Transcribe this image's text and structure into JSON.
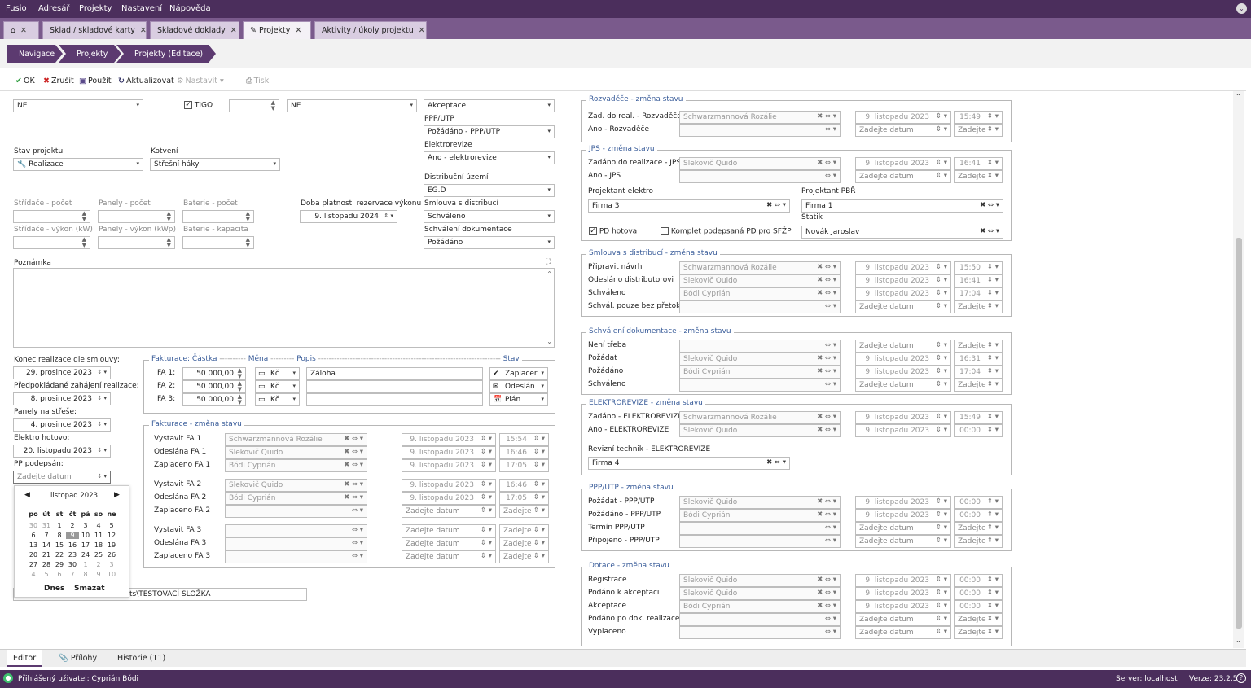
{
  "menu": [
    "Fusio",
    "Adresář",
    "Projekty",
    "Nastavení",
    "Nápověda"
  ],
  "tabs": [
    {
      "label": "Sklad / skladové karty"
    },
    {
      "label": "Skladové doklady"
    },
    {
      "label": "Projekty"
    },
    {
      "label": "Aktivity / úkoly projektu"
    }
  ],
  "breadcrumb": [
    "Navigace",
    "Projekty",
    "Projekty (Editace)"
  ],
  "toolbar": {
    "ok": "OK",
    "cancel": "Zrušit",
    "apply": "Použít",
    "refresh": "Aktualizovat",
    "settings": "Nastavit",
    "print": "Tisk"
  },
  "left": {
    "top_select1": "NE",
    "tigo_label": "TIGO",
    "top_select2": "NE",
    "acceptance_select": "Akceptace",
    "ppp_label": "PPP/UTP",
    "ppp_value": "Požádáno - PPP/UTP",
    "elektro_label": "Elektrorevize",
    "elektro_value": "Ano - elektrorevize",
    "stav_label": "Stav projektu",
    "stav_value": "Realizace",
    "kotveni_label": "Kotvení",
    "kotveni_value": "Střešní háky",
    "distrib_label": "Distribuční území",
    "distrib_value": "EG.D",
    "stridace_pocet": "Střídače - počet",
    "panely_pocet": "Panely - počet",
    "baterie_pocet": "Baterie - počet",
    "doba_label": "Doba platnosti rezervace výkonu",
    "doba_value": "9. listopadu 2024",
    "smlouva_label": "Smlouva s distribucí",
    "smlouva_value": "Schváleno",
    "stridace_vykon": "Střídače - výkon (kW)",
    "panely_vykon": "Panely - výkon (kWp)",
    "baterie_kapacita": "Baterie - kapacita",
    "schvaleni_label": "Schválení dokumentace",
    "schvaleni_value": "Požádáno",
    "poznamka_label": "Poznámka",
    "konec_label": "Konec realizace dle smlouvy:",
    "konec_value": "29. prosince 2023",
    "predpokl_label": "Předpokládané zahájení realizace:",
    "predpokl_value": "8. prosince 2023",
    "panely_strecha_label": "Panely na střeše:",
    "panely_strecha_value": "4. prosince 2023",
    "elektro_hotovo_label": "Elektro hotovo:",
    "elektro_hotovo_value": "20. listopadu 2023",
    "pp_label": "PP podepsán:",
    "pp_placeholder": "Zadejte datum",
    "path_value": "ts\\TESTOVACÍ SLOŽKA"
  },
  "fakturace": {
    "header_label": "Fakturace:",
    "col_castka": "Částka",
    "col_mena": "Měna",
    "col_popis": "Popis",
    "col_stav": "Stav",
    "sep1": "----------",
    "sep2": "---------",
    "sep3": "---------------------------------------------------------------------",
    "rows": [
      {
        "label": "FA 1:",
        "amount": "50 000,00",
        "currency": "Kč",
        "desc": "Záloha",
        "status": "Zaplacer"
      },
      {
        "label": "FA 2:",
        "amount": "50 000,00",
        "currency": "Kč",
        "desc": "",
        "status": "Odeslán"
      },
      {
        "label": "FA 3:",
        "amount": "50 000,00",
        "currency": "Kč",
        "desc": "",
        "status": "Plán"
      }
    ]
  },
  "fakturace_zmena": {
    "title": "Fakturace - změna stavu",
    "rows": [
      {
        "label": "Vystavit FA 1",
        "person": "Schwarzmannová Rozálie",
        "date": "9. listopadu 2023",
        "time": "15:54"
      },
      {
        "label": "Odeslána FA 1",
        "person": "Slekovič Quido",
        "date": "9. listopadu 2023",
        "time": "16:46"
      },
      {
        "label": "Zaplaceno FA 1",
        "person": "Bódi Cyprián",
        "date": "9. listopadu 2023",
        "time": "17:05"
      },
      {
        "label": "Vystavit FA 2",
        "person": "Slekovič Quido",
        "date": "9. listopadu 2023",
        "time": "16:46"
      },
      {
        "label": "Odeslána FA 2",
        "person": "Bódi Cyprián",
        "date": "9. listopadu 2023",
        "time": "17:05"
      },
      {
        "label": "Zaplaceno FA 2",
        "person": "",
        "date": "Zadejte datum",
        "time": "Zadejte"
      },
      {
        "label": "Vystavit FA 3",
        "person": "",
        "date": "Zadejte datum",
        "time": "Zadejte"
      },
      {
        "label": "Odeslána FA 3",
        "person": "",
        "date": "Zadejte datum",
        "time": "Zadejte"
      },
      {
        "label": "Zaplaceno FA 3",
        "person": "",
        "date": "Zadejte datum",
        "time": "Zadejte"
      }
    ]
  },
  "calendar": {
    "month": "listopad 2023",
    "days": [
      "po",
      "út",
      "st",
      "čt",
      "pá",
      "so",
      "ne"
    ],
    "weeks": [
      [
        "30",
        "31",
        "1",
        "2",
        "3",
        "4",
        "5"
      ],
      [
        "6",
        "7",
        "8",
        "9",
        "10",
        "11",
        "12"
      ],
      [
        "13",
        "14",
        "15",
        "16",
        "17",
        "18",
        "19"
      ],
      [
        "20",
        "21",
        "22",
        "23",
        "24",
        "25",
        "26"
      ],
      [
        "27",
        "28",
        "29",
        "30",
        "1",
        "2",
        "3"
      ],
      [
        "4",
        "5",
        "6",
        "7",
        "8",
        "9",
        "10"
      ]
    ],
    "today": "Dnes",
    "clear": "Smazat"
  },
  "right": {
    "rozvadece": {
      "title": "Rozvaděče - změna stavu",
      "rows": [
        {
          "label": "Zad. do real. - Rozvaděče",
          "person": "Schwarzmannová Rozálie",
          "date": "9. listopadu 2023",
          "time": "15:49"
        },
        {
          "label": "Ano - Rozvaděče",
          "person": "",
          "date": "Zadejte datum",
          "time": "Zadejte"
        }
      ]
    },
    "jps": {
      "title": "JPS - změna stavu",
      "rows": [
        {
          "label": "Zadáno do realizace - JPS",
          "person": "Slekovič Quido",
          "date": "9. listopadu 2023",
          "time": "16:41"
        },
        {
          "label": "Ano - JPS",
          "person": "",
          "date": "Zadejte datum",
          "time": "Zadejte"
        }
      ],
      "projektant_elektro_label": "Projektant elektro",
      "projektant_elektro": "Firma 3",
      "projektant_pbr_label": "Projektant PBŘ",
      "projektant_pbr": "Firma 1",
      "statik_label": "Statik",
      "statik": "Novák Jaroslav",
      "pd_hotova": "PD hotova",
      "komplet": "Komplet podepsaná PD pro SFŽP"
    },
    "smlouva": {
      "title": "Smlouva s distribucí - změna stavu",
      "rows": [
        {
          "label": "Připravit návrh",
          "person": "Schwarzmannová Rozálie",
          "date": "9. listopadu 2023",
          "time": "15:50"
        },
        {
          "label": "Odesláno distributorovi",
          "person": "Slekovič Quido",
          "date": "9. listopadu 2023",
          "time": "16:41"
        },
        {
          "label": "Schváleno",
          "person": "Bódi Cyprián",
          "date": "9. listopadu 2023",
          "time": "17:04"
        },
        {
          "label": "Schvál. pouze bez přetoku",
          "person": "",
          "date": "Zadejte datum",
          "time": "Zadejte"
        }
      ]
    },
    "schvaleni": {
      "title": "Schválení dokumentace - změna stavu",
      "rows": [
        {
          "label": "Není třeba",
          "person": "",
          "date": "Zadejte datum",
          "time": "Zadejte"
        },
        {
          "label": "Požádat",
          "person": "Slekovič Quido",
          "date": "9. listopadu 2023",
          "time": "16:31"
        },
        {
          "label": "Požádáno",
          "person": "Bódi Cyprián",
          "date": "9. listopadu 2023",
          "time": "17:04"
        },
        {
          "label": "Schváleno",
          "person": "",
          "date": "Zadejte datum",
          "time": "Zadejte"
        }
      ]
    },
    "elektrorevize": {
      "title": "ELEKTROREVIZE - změna stavu",
      "rows": [
        {
          "label": "Zadáno - ELEKTROREVIZE",
          "person": "Schwarzmannová Rozálie",
          "date": "9. listopadu 2023",
          "time": "15:49"
        },
        {
          "label": "Ano - ELEKTROREVIZE",
          "person": "Slekovič Quido",
          "date": "9. listopadu 2023",
          "time": "00:00"
        }
      ],
      "technik_label": "Revizní technik - ELEKTROREVIZE",
      "technik": "Firma 4"
    },
    "ppp": {
      "title": "PPP/UTP - změna stavu",
      "rows": [
        {
          "label": "Požádat - PPP/UTP",
          "person": "Slekovič Quido",
          "date": "9. listopadu 2023",
          "time": "00:00"
        },
        {
          "label": "Požádáno - PPP/UTP",
          "person": "Bódi Cyprián",
          "date": "9. listopadu 2023",
          "time": "00:00"
        },
        {
          "label": "Termín PPP/UTP",
          "person": "",
          "date": "Zadejte datum",
          "time": "Zadejte"
        },
        {
          "label": "Připojeno - PPP/UTP",
          "person": "",
          "date": "Zadejte datum",
          "time": "Zadejte"
        }
      ]
    },
    "dotace": {
      "title": "Dotace - změna stavu",
      "rows": [
        {
          "label": "Registrace",
          "person": "Slekovič Quido",
          "date": "9. listopadu 2023",
          "time": "00:00"
        },
        {
          "label": "Podáno k akceptaci",
          "person": "Slekovič Quido",
          "date": "9. listopadu 2023",
          "time": "00:00"
        },
        {
          "label": "Akceptace",
          "person": "Bódi Cyprián",
          "date": "9. listopadu 2023",
          "time": "00:00"
        },
        {
          "label": "Podáno po dok. realizace",
          "person": "",
          "date": "Zadejte datum",
          "time": "Zadejte"
        },
        {
          "label": "Vyplaceno",
          "person": "",
          "date": "Zadejte datum",
          "time": "Zadejte"
        }
      ]
    }
  },
  "bottom_tabs": [
    "Editor",
    "Přílohy",
    "Historie (11)"
  ],
  "status": {
    "user": "Přihlášený uživatel: Cyprián Bódi",
    "server": "Server: localhost",
    "version": "Verze: 23.2.5"
  }
}
